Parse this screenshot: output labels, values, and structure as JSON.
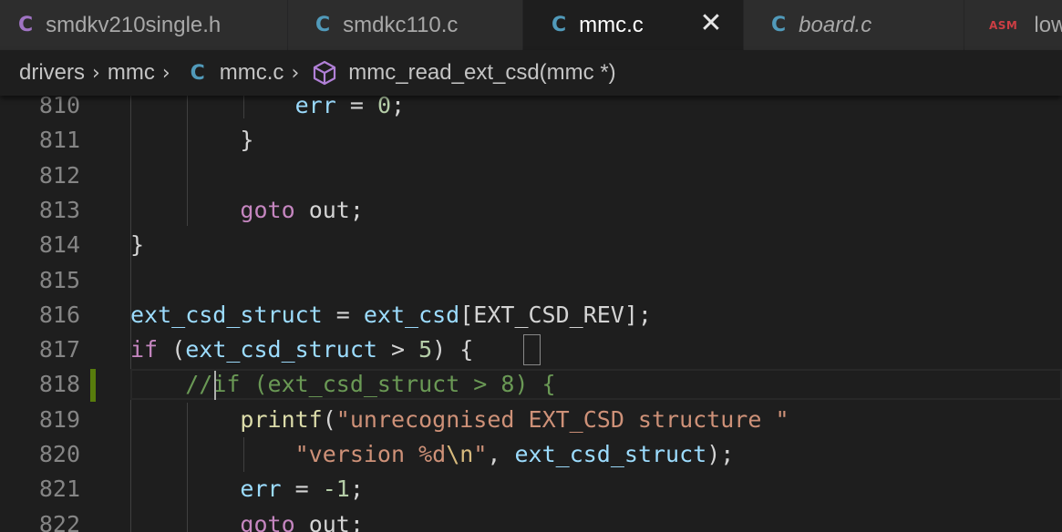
{
  "tabs": [
    {
      "lang": "C",
      "title": "smdkv210single.h",
      "italic": false,
      "active": false,
      "lang_color": "#a074c4"
    },
    {
      "lang": "C",
      "title": "smdkc110.c",
      "italic": false,
      "active": false,
      "lang_color": "#519aba"
    },
    {
      "lang": "C",
      "title": "mmc.c",
      "italic": false,
      "active": true,
      "lang_color": "#519aba",
      "close": "✕"
    },
    {
      "lang": "C",
      "title": "board.c",
      "italic": true,
      "active": false,
      "lang_color": "#519aba"
    },
    {
      "lang": "ASM",
      "title": "low",
      "italic": false,
      "active": false,
      "lang_color": "#cc3e44"
    }
  ],
  "breadcrumb": {
    "folder1": "drivers",
    "folder2": "mmc",
    "file_icon": "C",
    "file": "mmc.c",
    "symbol_icon": "cube-icon",
    "symbol": "mmc_read_ext_csd(mmc *)",
    "sep": "›"
  },
  "editor": {
    "lines": [
      {
        "num": "810",
        "indent": "        ",
        "tokens": [
          [
            "id",
            "err"
          ],
          [
            "mac",
            " = "
          ],
          [
            "num",
            "0"
          ],
          [
            "mac",
            ";"
          ]
        ]
      },
      {
        "num": "811",
        "indent": "    ",
        "tokens": [
          [
            "mac",
            "}"
          ]
        ]
      },
      {
        "num": "812",
        "indent": "",
        "tokens": []
      },
      {
        "num": "813",
        "indent": "    ",
        "tokens": [
          [
            "kw",
            "goto"
          ],
          [
            "mac",
            " out;"
          ]
        ]
      },
      {
        "num": "814",
        "indent": "",
        "tokens": [
          [
            "mac",
            "}"
          ]
        ]
      },
      {
        "num": "815",
        "indent": "",
        "tokens": []
      },
      {
        "num": "816",
        "indent": "",
        "tokens": [
          [
            "id",
            "ext_csd_struct"
          ],
          [
            "mac",
            " = "
          ],
          [
            "id",
            "ext_csd"
          ],
          [
            "mac",
            "[EXT_CSD_REV];"
          ]
        ]
      },
      {
        "num": "817",
        "indent": "",
        "tokens": [
          [
            "kw",
            "if"
          ],
          [
            "mac",
            " ("
          ],
          [
            "id",
            "ext_csd_struct"
          ],
          [
            "mac",
            " > "
          ],
          [
            "num",
            "5"
          ],
          [
            "mac",
            ") {"
          ]
        ]
      },
      {
        "num": "818",
        "indent": "",
        "tokens": [
          [
            "cm",
            "//if (ext_csd_struct > 8) {"
          ]
        ]
      },
      {
        "num": "819",
        "indent": "    ",
        "tokens": [
          [
            "fn",
            "printf"
          ],
          [
            "mac",
            "("
          ],
          [
            "str",
            "\"unrecognised EXT_CSD structure \""
          ]
        ]
      },
      {
        "num": "820",
        "indent": "        ",
        "tokens": [
          [
            "str",
            "\"version %d"
          ],
          [
            "esc",
            "\\n"
          ],
          [
            "str",
            "\""
          ],
          [
            "mac",
            ", "
          ],
          [
            "id",
            "ext_csd_struct"
          ],
          [
            "mac",
            ");"
          ]
        ]
      },
      {
        "num": "821",
        "indent": "    ",
        "tokens": [
          [
            "id",
            "err"
          ],
          [
            "mac",
            " = "
          ],
          [
            "num",
            "-1"
          ],
          [
            "mac",
            ";"
          ]
        ]
      },
      {
        "num": "822",
        "indent": "    ",
        "tokens": [
          [
            "kw",
            "goto"
          ],
          [
            "mac",
            " out;"
          ]
        ]
      }
    ]
  },
  "colors": {
    "background": "#1e1e1e",
    "tabbar": "#252526",
    "keyword": "#c586c0",
    "variable": "#9cdcfe",
    "number": "#b5cea8",
    "string": "#ce9178",
    "function": "#dcdcaa",
    "comment": "#6a9955",
    "modified_gutter": "#587c0c"
  }
}
